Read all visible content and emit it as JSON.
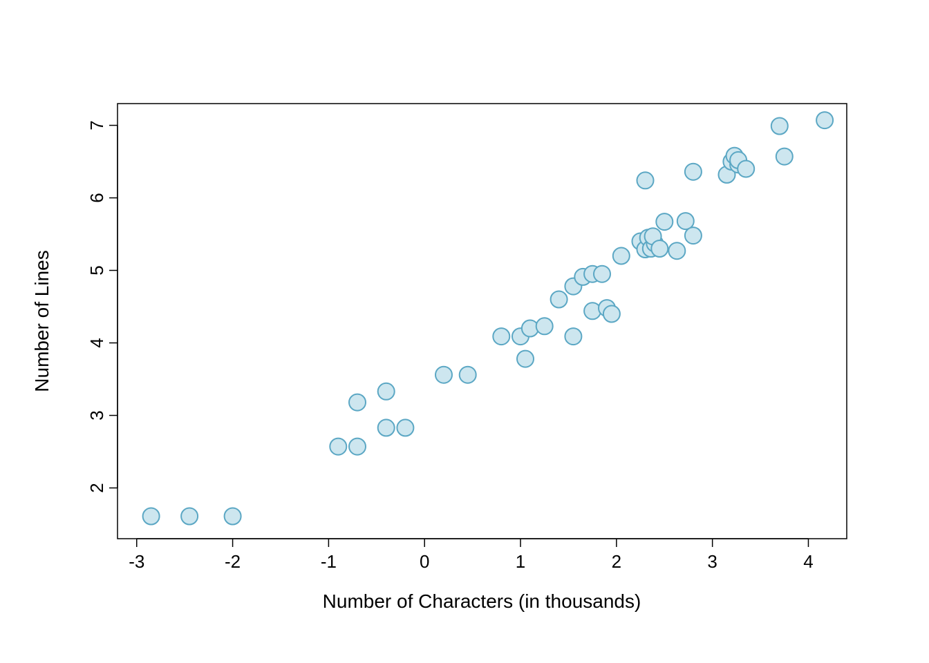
{
  "chart_data": {
    "type": "scatter",
    "xlabel": "Number of Characters (in thousands)",
    "ylabel": "Number of Lines",
    "xlim": [
      -3.2,
      4.4
    ],
    "ylim": [
      1.3,
      7.3
    ],
    "x_ticks": [
      -3,
      -2,
      -1,
      0,
      1,
      2,
      3,
      4
    ],
    "y_ticks": [
      2,
      3,
      4,
      5,
      6,
      7
    ],
    "point_color": "#cde6ef",
    "point_stroke": "#5ba7c4",
    "points": [
      {
        "x": -2.85,
        "y": 1.61
      },
      {
        "x": -2.45,
        "y": 1.61
      },
      {
        "x": -2.0,
        "y": 1.61
      },
      {
        "x": -0.9,
        "y": 2.57
      },
      {
        "x": -0.7,
        "y": 2.57
      },
      {
        "x": -0.7,
        "y": 3.18
      },
      {
        "x": -0.4,
        "y": 3.33
      },
      {
        "x": -0.4,
        "y": 2.83
      },
      {
        "x": -0.2,
        "y": 2.83
      },
      {
        "x": 0.2,
        "y": 3.56
      },
      {
        "x": 0.45,
        "y": 3.56
      },
      {
        "x": 0.8,
        "y": 4.09
      },
      {
        "x": 1.0,
        "y": 4.09
      },
      {
        "x": 1.05,
        "y": 3.78
      },
      {
        "x": 1.1,
        "y": 4.2
      },
      {
        "x": 1.25,
        "y": 4.23
      },
      {
        "x": 1.4,
        "y": 4.6
      },
      {
        "x": 1.55,
        "y": 4.78
      },
      {
        "x": 1.55,
        "y": 4.09
      },
      {
        "x": 1.65,
        "y": 4.91
      },
      {
        "x": 1.75,
        "y": 4.95
      },
      {
        "x": 1.75,
        "y": 4.44
      },
      {
        "x": 1.85,
        "y": 4.95
      },
      {
        "x": 1.9,
        "y": 4.48
      },
      {
        "x": 1.95,
        "y": 4.4
      },
      {
        "x": 2.05,
        "y": 5.2
      },
      {
        "x": 2.25,
        "y": 5.4
      },
      {
        "x": 2.3,
        "y": 6.24
      },
      {
        "x": 2.3,
        "y": 5.29
      },
      {
        "x": 2.33,
        "y": 5.45
      },
      {
        "x": 2.36,
        "y": 5.3
      },
      {
        "x": 2.4,
        "y": 5.37
      },
      {
        "x": 2.38,
        "y": 5.47
      },
      {
        "x": 2.45,
        "y": 5.3
      },
      {
        "x": 2.5,
        "y": 5.67
      },
      {
        "x": 2.63,
        "y": 5.27
      },
      {
        "x": 2.72,
        "y": 5.68
      },
      {
        "x": 2.8,
        "y": 6.36
      },
      {
        "x": 2.8,
        "y": 5.48
      },
      {
        "x": 3.15,
        "y": 6.32
      },
      {
        "x": 3.2,
        "y": 6.5
      },
      {
        "x": 3.23,
        "y": 6.58
      },
      {
        "x": 3.27,
        "y": 6.46
      },
      {
        "x": 3.27,
        "y": 6.52
      },
      {
        "x": 3.35,
        "y": 6.4
      },
      {
        "x": 3.7,
        "y": 6.99
      },
      {
        "x": 3.75,
        "y": 6.57
      },
      {
        "x": 4.17,
        "y": 7.07
      }
    ]
  }
}
